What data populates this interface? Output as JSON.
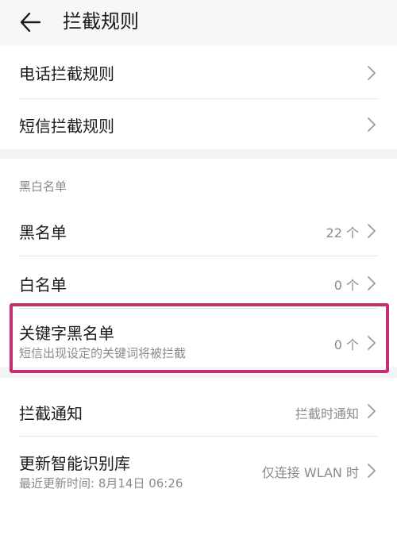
{
  "header": {
    "title": "拦截规则"
  },
  "section1": {
    "items": [
      {
        "label": "电话拦截规则"
      },
      {
        "label": "短信拦截规则"
      }
    ]
  },
  "section2": {
    "header": "黑白名单",
    "items": [
      {
        "label": "黑名单",
        "value": "22 个"
      },
      {
        "label": "白名单",
        "value": "0 个"
      },
      {
        "label": "关键字黑名单",
        "sub": "短信出现设定的关键词将被拦截",
        "value": "0 个"
      }
    ]
  },
  "section3": {
    "items": [
      {
        "label": "拦截通知",
        "value": "拦截时通知"
      },
      {
        "label": "更新智能识别库",
        "sub": "最近更新时间: 8月14日 06:26",
        "value": "仅连接 WLAN 时"
      }
    ]
  },
  "colors": {
    "highlight": "#c2306f",
    "text_secondary": "#8a8a8a"
  }
}
